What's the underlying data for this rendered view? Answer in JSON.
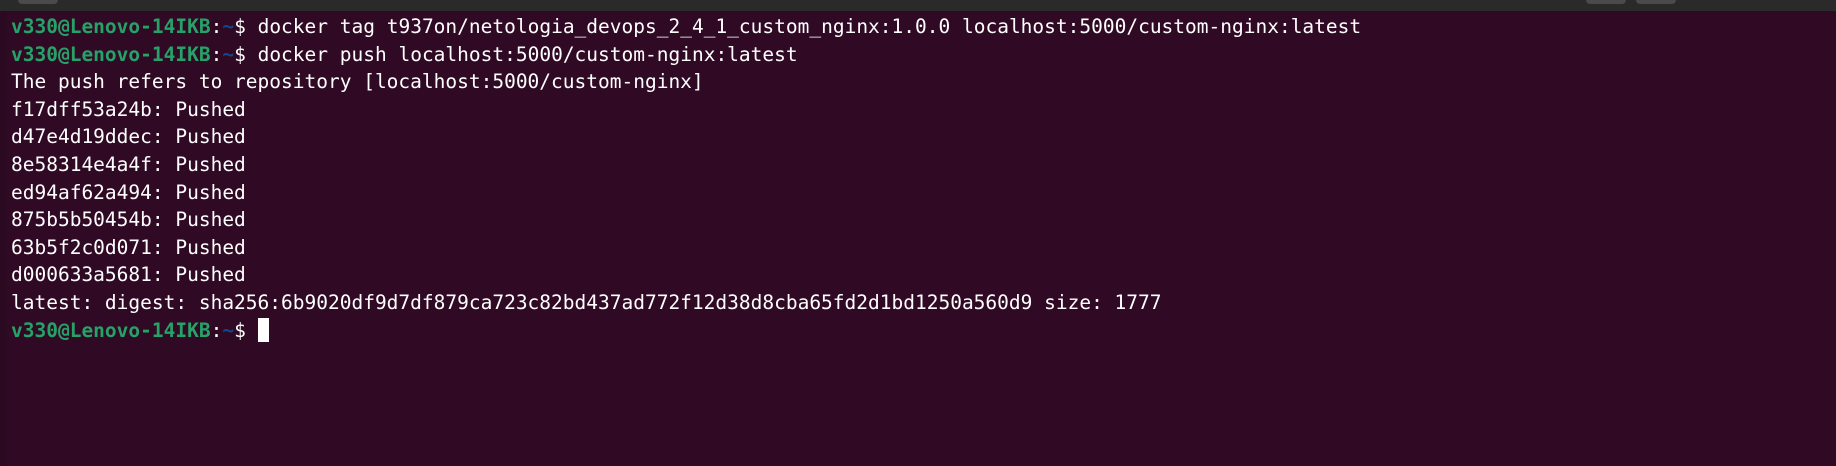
{
  "terminal": {
    "user_host": "v330@Lenovo-14IKB",
    "sep": ":",
    "path": "~",
    "prompt_symbol": "$ ",
    "lines": [
      {
        "kind": "prompt",
        "command": "docker tag t937on/netologia_devops_2_4_1_custom_nginx:1.0.0 localhost:5000/custom-nginx:latest"
      },
      {
        "kind": "prompt",
        "command": "docker push localhost:5000/custom-nginx:latest"
      },
      {
        "kind": "output",
        "text": "The push refers to repository [localhost:5000/custom-nginx]"
      },
      {
        "kind": "output",
        "text": "f17dff53a24b: Pushed"
      },
      {
        "kind": "output",
        "text": "d47e4d19ddec: Pushed"
      },
      {
        "kind": "output",
        "text": "8e58314e4a4f: Pushed"
      },
      {
        "kind": "output",
        "text": "ed94af62a494: Pushed"
      },
      {
        "kind": "output",
        "text": "875b5b50454b: Pushed"
      },
      {
        "kind": "output",
        "text": "63b5f2c0d071: Pushed"
      },
      {
        "kind": "output",
        "text": "d000633a5681: Pushed"
      },
      {
        "kind": "output",
        "text": "latest: digest: sha256:6b9020df9d7df879ca723c82bd437ad772f12d38d8cba65fd2d1bd1250a560d9 size: 1777"
      },
      {
        "kind": "prompt",
        "command": "",
        "cursor": true
      }
    ]
  },
  "colors": {
    "background": "#300a24",
    "text": "#ffffff",
    "user_host": "#26a269",
    "path": "#12488b"
  }
}
